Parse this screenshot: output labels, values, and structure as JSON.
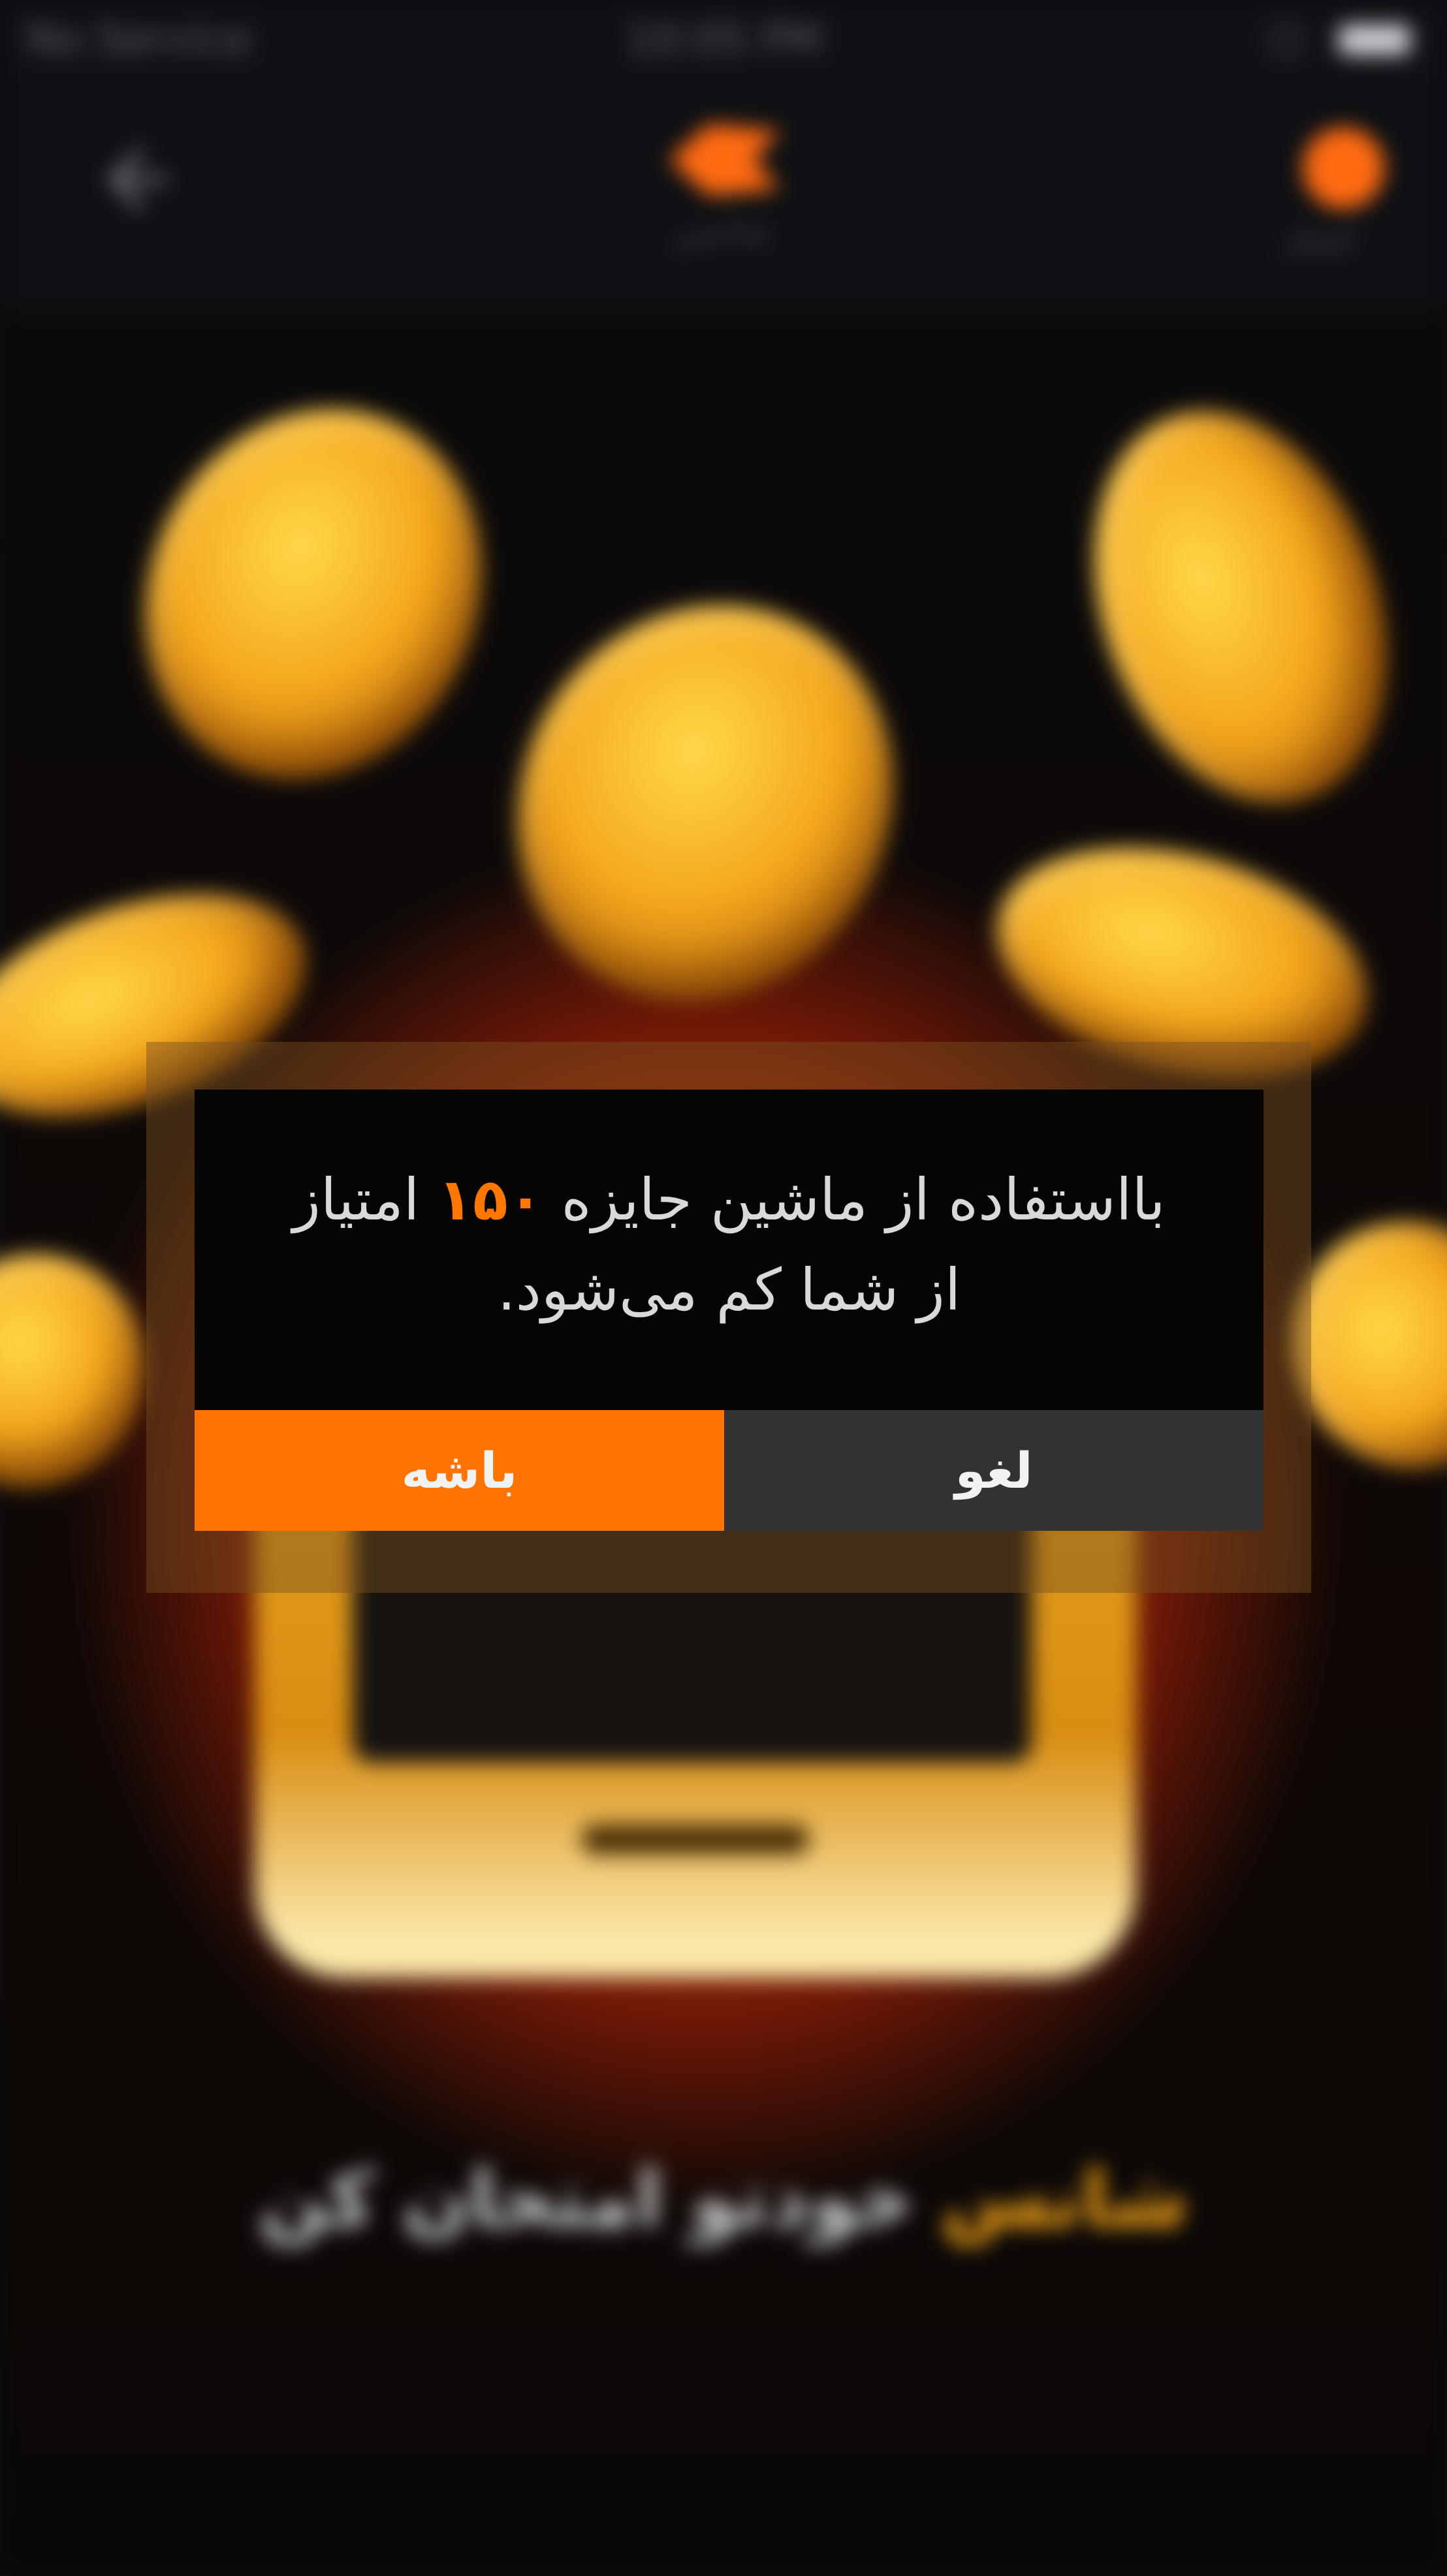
{
  "status_bar": {
    "carrier": "No Service",
    "time": "10:05 PM"
  },
  "header": {
    "logo_caption": "شانس",
    "points_caption": "امتیاز"
  },
  "background": {
    "tagline_accent": "شانس",
    "tagline_rest": "خودتو امتحان کن"
  },
  "dialog": {
    "line1_part1": "بااستفاده از ماشین جایزه",
    "points": "۱۵۰",
    "line1_part2": "امتیاز",
    "line2": "از شما کم می‌شود.",
    "ok_label": "باشه",
    "cancel_label": "لغو"
  },
  "colors": {
    "accent": "#ff7300",
    "cancel_bg": "#323232",
    "dialog_bg": "#070504"
  }
}
